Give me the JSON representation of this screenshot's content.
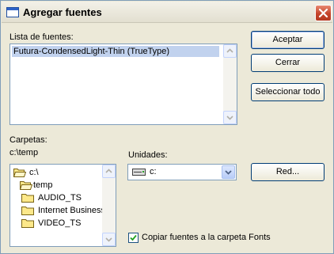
{
  "window": {
    "title": "Agregar fuentes"
  },
  "fonts_list": {
    "label": "Lista de fuentes:",
    "items": [
      "Futura-CondensedLight-Thin (TrueType)"
    ]
  },
  "buttons": {
    "accept": "Aceptar",
    "close": "Cerrar",
    "select_all": "Seleccionar todo",
    "network": "Red..."
  },
  "folders": {
    "label": "Carpetas:",
    "current_path": "c:\\temp",
    "tree": [
      "c:\\",
      "temp",
      "AUDIO_TS",
      "Internet Business",
      "VIDEO_TS"
    ]
  },
  "drives": {
    "label": "Unidades:",
    "selected": "c:"
  },
  "copy_option": {
    "label": "Copiar fuentes a la carpeta Fonts",
    "checked": true
  }
}
